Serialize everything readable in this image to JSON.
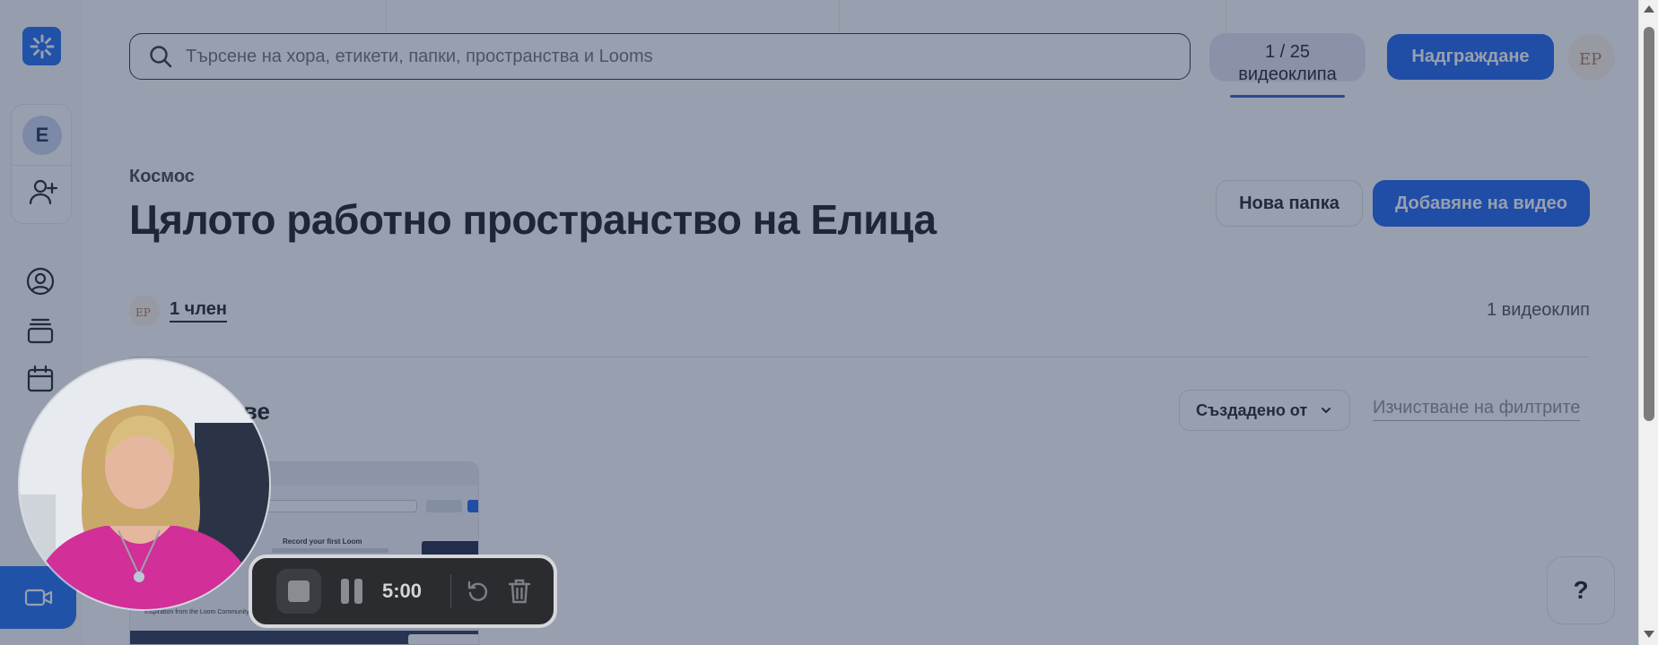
{
  "search": {
    "placeholder": "Търсене на хора, етикети, папки, пространства и Looms"
  },
  "quota": {
    "count": "1 / 25",
    "unit": "видеоклипа"
  },
  "header": {
    "upgrade_label": "Надграждане",
    "avatar_initials": "EP"
  },
  "sidebar": {
    "workspace_initial": "Е"
  },
  "space": {
    "breadcrumb": "Космос",
    "title": "Цялото работно пространство на Елица",
    "new_folder_label": "Нова папка",
    "add_video_label": "Добавяне на видео",
    "members_label": "1 член",
    "video_count": "1 видеоклип"
  },
  "videos": {
    "section_title": "ове",
    "filter_label": "Създадено от",
    "clear_filters_label": "Изчистване на филтрите"
  },
  "thumbnail": {
    "record_text": "Record your first Loom",
    "inspiration_text": "Inspiration from the Loom Community"
  },
  "help": {
    "label": "?"
  },
  "recorder": {
    "time": "5:00"
  },
  "colors": {
    "accent": "#1a63ef",
    "overlay": "rgba(40,55,85,0.48)",
    "recorder_bg": "#2b2c30"
  }
}
